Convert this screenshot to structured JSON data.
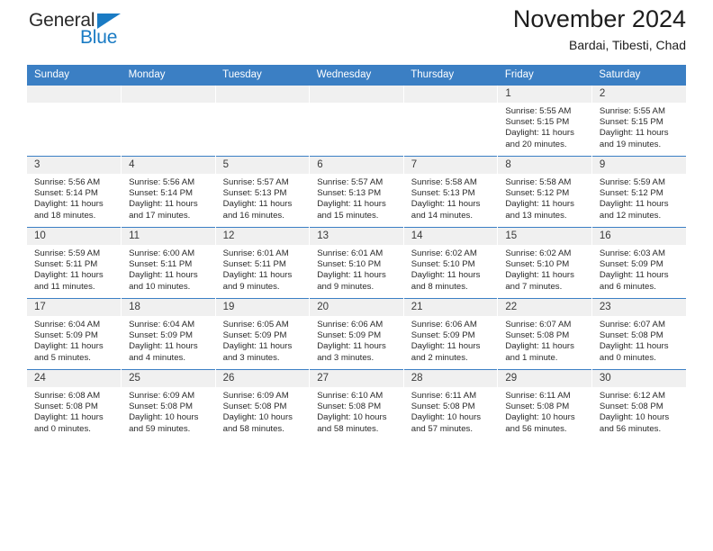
{
  "brand": {
    "name_part1": "General",
    "name_part2": "Blue",
    "triangle_color": "#1a7bc4"
  },
  "header": {
    "title": "November 2024",
    "subtitle": "Bardai, Tibesti, Chad"
  },
  "theme": {
    "header_band": "#3b7fc4",
    "daynum_band": "#f0f0f0",
    "text": "#2a2a2a"
  },
  "labels": {
    "sunrise_prefix": "Sunrise: ",
    "sunset_prefix": "Sunset: ",
    "daylight_prefix": "Daylight: "
  },
  "weekdays": [
    "Sunday",
    "Monday",
    "Tuesday",
    "Wednesday",
    "Thursday",
    "Friday",
    "Saturday"
  ],
  "weeks": [
    [
      {
        "blank": true,
        "day": ""
      },
      {
        "blank": true,
        "day": ""
      },
      {
        "blank": true,
        "day": ""
      },
      {
        "blank": true,
        "day": ""
      },
      {
        "blank": true,
        "day": ""
      },
      {
        "blank": false,
        "day": "1",
        "sunrise": "Sunrise: 5:55 AM",
        "sunset": "Sunset: 5:15 PM",
        "daylight": "Daylight: 11 hours and 20 minutes."
      },
      {
        "blank": false,
        "day": "2",
        "sunrise": "Sunrise: 5:55 AM",
        "sunset": "Sunset: 5:15 PM",
        "daylight": "Daylight: 11 hours and 19 minutes."
      }
    ],
    [
      {
        "blank": false,
        "day": "3",
        "sunrise": "Sunrise: 5:56 AM",
        "sunset": "Sunset: 5:14 PM",
        "daylight": "Daylight: 11 hours and 18 minutes."
      },
      {
        "blank": false,
        "day": "4",
        "sunrise": "Sunrise: 5:56 AM",
        "sunset": "Sunset: 5:14 PM",
        "daylight": "Daylight: 11 hours and 17 minutes."
      },
      {
        "blank": false,
        "day": "5",
        "sunrise": "Sunrise: 5:57 AM",
        "sunset": "Sunset: 5:13 PM",
        "daylight": "Daylight: 11 hours and 16 minutes."
      },
      {
        "blank": false,
        "day": "6",
        "sunrise": "Sunrise: 5:57 AM",
        "sunset": "Sunset: 5:13 PM",
        "daylight": "Daylight: 11 hours and 15 minutes."
      },
      {
        "blank": false,
        "day": "7",
        "sunrise": "Sunrise: 5:58 AM",
        "sunset": "Sunset: 5:13 PM",
        "daylight": "Daylight: 11 hours and 14 minutes."
      },
      {
        "blank": false,
        "day": "8",
        "sunrise": "Sunrise: 5:58 AM",
        "sunset": "Sunset: 5:12 PM",
        "daylight": "Daylight: 11 hours and 13 minutes."
      },
      {
        "blank": false,
        "day": "9",
        "sunrise": "Sunrise: 5:59 AM",
        "sunset": "Sunset: 5:12 PM",
        "daylight": "Daylight: 11 hours and 12 minutes."
      }
    ],
    [
      {
        "blank": false,
        "day": "10",
        "sunrise": "Sunrise: 5:59 AM",
        "sunset": "Sunset: 5:11 PM",
        "daylight": "Daylight: 11 hours and 11 minutes."
      },
      {
        "blank": false,
        "day": "11",
        "sunrise": "Sunrise: 6:00 AM",
        "sunset": "Sunset: 5:11 PM",
        "daylight": "Daylight: 11 hours and 10 minutes."
      },
      {
        "blank": false,
        "day": "12",
        "sunrise": "Sunrise: 6:01 AM",
        "sunset": "Sunset: 5:11 PM",
        "daylight": "Daylight: 11 hours and 9 minutes."
      },
      {
        "blank": false,
        "day": "13",
        "sunrise": "Sunrise: 6:01 AM",
        "sunset": "Sunset: 5:10 PM",
        "daylight": "Daylight: 11 hours and 9 minutes."
      },
      {
        "blank": false,
        "day": "14",
        "sunrise": "Sunrise: 6:02 AM",
        "sunset": "Sunset: 5:10 PM",
        "daylight": "Daylight: 11 hours and 8 minutes."
      },
      {
        "blank": false,
        "day": "15",
        "sunrise": "Sunrise: 6:02 AM",
        "sunset": "Sunset: 5:10 PM",
        "daylight": "Daylight: 11 hours and 7 minutes."
      },
      {
        "blank": false,
        "day": "16",
        "sunrise": "Sunrise: 6:03 AM",
        "sunset": "Sunset: 5:09 PM",
        "daylight": "Daylight: 11 hours and 6 minutes."
      }
    ],
    [
      {
        "blank": false,
        "day": "17",
        "sunrise": "Sunrise: 6:04 AM",
        "sunset": "Sunset: 5:09 PM",
        "daylight": "Daylight: 11 hours and 5 minutes."
      },
      {
        "blank": false,
        "day": "18",
        "sunrise": "Sunrise: 6:04 AM",
        "sunset": "Sunset: 5:09 PM",
        "daylight": "Daylight: 11 hours and 4 minutes."
      },
      {
        "blank": false,
        "day": "19",
        "sunrise": "Sunrise: 6:05 AM",
        "sunset": "Sunset: 5:09 PM",
        "daylight": "Daylight: 11 hours and 3 minutes."
      },
      {
        "blank": false,
        "day": "20",
        "sunrise": "Sunrise: 6:06 AM",
        "sunset": "Sunset: 5:09 PM",
        "daylight": "Daylight: 11 hours and 3 minutes."
      },
      {
        "blank": false,
        "day": "21",
        "sunrise": "Sunrise: 6:06 AM",
        "sunset": "Sunset: 5:09 PM",
        "daylight": "Daylight: 11 hours and 2 minutes."
      },
      {
        "blank": false,
        "day": "22",
        "sunrise": "Sunrise: 6:07 AM",
        "sunset": "Sunset: 5:08 PM",
        "daylight": "Daylight: 11 hours and 1 minute."
      },
      {
        "blank": false,
        "day": "23",
        "sunrise": "Sunrise: 6:07 AM",
        "sunset": "Sunset: 5:08 PM",
        "daylight": "Daylight: 11 hours and 0 minutes."
      }
    ],
    [
      {
        "blank": false,
        "day": "24",
        "sunrise": "Sunrise: 6:08 AM",
        "sunset": "Sunset: 5:08 PM",
        "daylight": "Daylight: 11 hours and 0 minutes."
      },
      {
        "blank": false,
        "day": "25",
        "sunrise": "Sunrise: 6:09 AM",
        "sunset": "Sunset: 5:08 PM",
        "daylight": "Daylight: 10 hours and 59 minutes."
      },
      {
        "blank": false,
        "day": "26",
        "sunrise": "Sunrise: 6:09 AM",
        "sunset": "Sunset: 5:08 PM",
        "daylight": "Daylight: 10 hours and 58 minutes."
      },
      {
        "blank": false,
        "day": "27",
        "sunrise": "Sunrise: 6:10 AM",
        "sunset": "Sunset: 5:08 PM",
        "daylight": "Daylight: 10 hours and 58 minutes."
      },
      {
        "blank": false,
        "day": "28",
        "sunrise": "Sunrise: 6:11 AM",
        "sunset": "Sunset: 5:08 PM",
        "daylight": "Daylight: 10 hours and 57 minutes."
      },
      {
        "blank": false,
        "day": "29",
        "sunrise": "Sunrise: 6:11 AM",
        "sunset": "Sunset: 5:08 PM",
        "daylight": "Daylight: 10 hours and 56 minutes."
      },
      {
        "blank": false,
        "day": "30",
        "sunrise": "Sunrise: 6:12 AM",
        "sunset": "Sunset: 5:08 PM",
        "daylight": "Daylight: 10 hours and 56 minutes."
      }
    ]
  ]
}
